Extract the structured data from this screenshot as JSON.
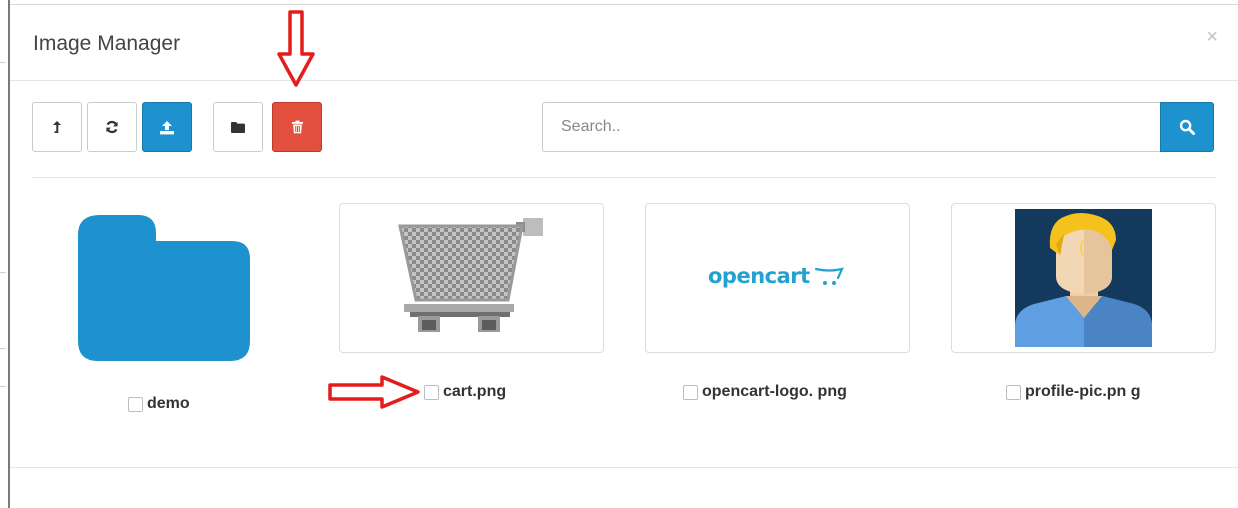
{
  "modal": {
    "title": "Image Manager",
    "close_label": "×"
  },
  "toolbar": {
    "buttons": [
      {
        "name": "parent-directory",
        "icon": "level-up-icon"
      },
      {
        "name": "refresh",
        "icon": "refresh-icon"
      },
      {
        "name": "upload",
        "icon": "upload-icon",
        "color": "#1e91cf"
      },
      {
        "name": "new-folder",
        "icon": "folder-icon"
      },
      {
        "name": "delete",
        "icon": "trash-icon",
        "color": "#e3503e"
      }
    ]
  },
  "search": {
    "placeholder": "Search..",
    "value": "",
    "button_icon": "search-icon"
  },
  "items": [
    {
      "type": "folder",
      "label": "demo",
      "icon": "folder-icon",
      "color": "#1e91cf"
    },
    {
      "type": "image",
      "label": "cart.png",
      "thumbnail": "shopping-cart-icon"
    },
    {
      "type": "image",
      "label": "opencart-logo. png",
      "thumbnail": "opencart-logo",
      "thumbnail_text": "opencart"
    },
    {
      "type": "image",
      "label": "profile-pic.pn g",
      "thumbnail": "avatar-icon"
    }
  ],
  "annotations": {
    "arrow_color": "#e51c1c"
  }
}
